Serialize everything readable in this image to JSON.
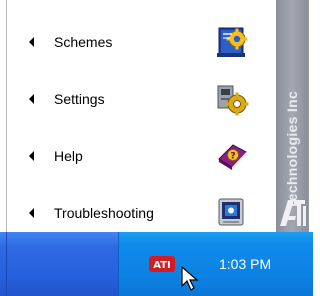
{
  "menu": {
    "items": [
      {
        "label": "Schemes",
        "icon": "schemes-icon"
      },
      {
        "label": "Settings",
        "icon": "settings-icon"
      },
      {
        "label": "Help",
        "icon": "help-book-icon"
      },
      {
        "label": "Troubleshooting",
        "icon": "troubleshooting-icon"
      }
    ],
    "submenu_arrow": "left-triangle"
  },
  "banner": {
    "text": "Technologies Inc",
    "logo": "ATI",
    "color": "#a0a5af"
  },
  "taskbar": {
    "tray_icon": "ati-tray-icon",
    "clock": "1:03 PM",
    "accent": "#245ad8",
    "tray_color": "#0f8aea"
  }
}
